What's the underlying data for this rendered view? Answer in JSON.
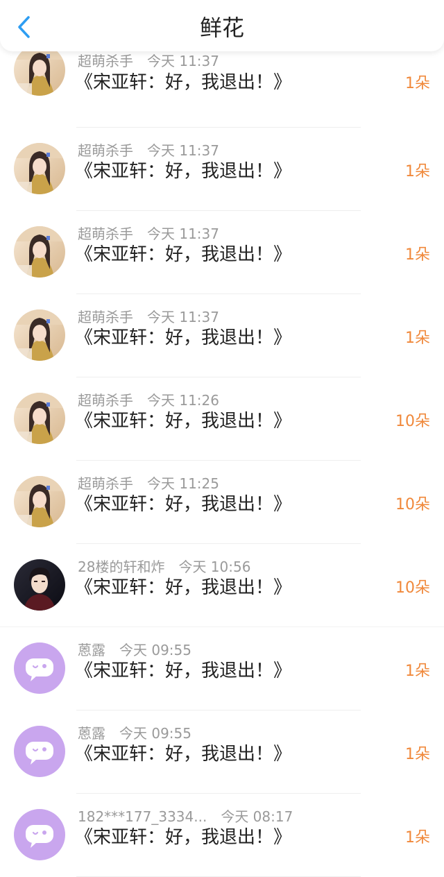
{
  "header": {
    "title": "鲜花"
  },
  "items": [
    {
      "user": "超萌杀手",
      "time": "今天 11:37",
      "message": "《宋亚轩：好，我退出！》",
      "count": "1朵",
      "avatar": "girl"
    },
    {
      "user": "超萌杀手",
      "time": "今天 11:37",
      "message": "《宋亚轩：好，我退出！》",
      "count": "1朵",
      "avatar": "girl"
    },
    {
      "user": "超萌杀手",
      "time": "今天 11:37",
      "message": "《宋亚轩：好，我退出！》",
      "count": "1朵",
      "avatar": "girl"
    },
    {
      "user": "超萌杀手",
      "time": "今天 11:37",
      "message": "《宋亚轩：好，我退出！》",
      "count": "1朵",
      "avatar": "girl"
    },
    {
      "user": "超萌杀手",
      "time": "今天 11:26",
      "message": "《宋亚轩：好，我退出！》",
      "count": "10朵",
      "avatar": "girl"
    },
    {
      "user": "超萌杀手",
      "time": "今天 11:25",
      "message": "《宋亚轩：好，我退出！》",
      "count": "10朵",
      "avatar": "girl"
    },
    {
      "user": "28楼的轩和炸",
      "time": "今天 10:56",
      "message": "《宋亚轩：好，我退出！》",
      "count": "10朵",
      "avatar": "boy"
    },
    {
      "user": "蒽露",
      "time": "今天 09:55",
      "message": "《宋亚轩：好，我退出！》",
      "count": "1朵",
      "avatar": "chat"
    },
    {
      "user": "蒽露",
      "time": "今天 09:55",
      "message": "《宋亚轩：好，我退出！》",
      "count": "1朵",
      "avatar": "chat"
    },
    {
      "user": "182***177_3334...",
      "time": "今天 08:17",
      "message": "《宋亚轩：好，我退出！》",
      "count": "1朵",
      "avatar": "chat"
    }
  ],
  "colors": {
    "accent_blue": "#2d9df2",
    "count_orange": "#f0883a",
    "meta_gray": "#9a9a9a",
    "chat_avatar_purple": "#c9a6ee"
  }
}
